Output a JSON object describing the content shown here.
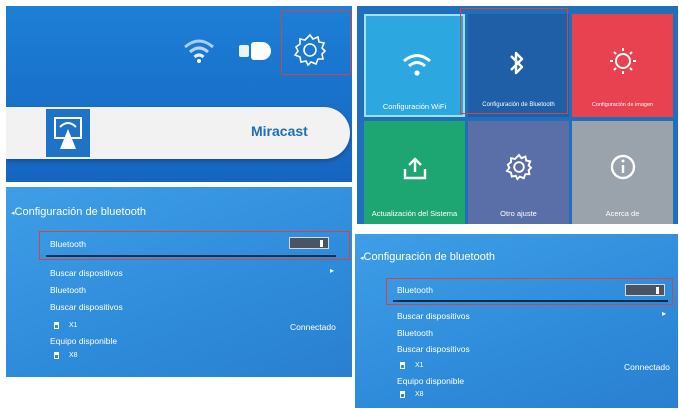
{
  "home": {
    "miracast_label": "Miracast",
    "icons": {
      "wifi": "wifi-icon",
      "usb": "usb-icon",
      "settings": "gear-icon",
      "miracast": "miracast-cast-icon"
    }
  },
  "settings_grid": {
    "tiles": [
      {
        "label": "Configuración WiFi",
        "icon": "wifi-icon",
        "color": "#2da7e0"
      },
      {
        "label": "Configuración de Bluetooth",
        "icon": "bluetooth-icon",
        "color": "#1e5fa8"
      },
      {
        "label": "Configuración de imagen",
        "icon": "sun-icon",
        "color": "#e8414f"
      },
      {
        "label": "Actualización del Sistema",
        "icon": "upload-icon",
        "color": "#1ea672"
      },
      {
        "label": "Otro ajuste",
        "icon": "gear-icon",
        "color": "#5a6ea8"
      },
      {
        "label": "Acerca de",
        "icon": "info-icon",
        "color": "#9aa2ab"
      }
    ]
  },
  "bluetooth_screen": {
    "title": "Configuración de bluetooth",
    "rows": {
      "bluetooth_toggle": "Bluetooth",
      "search_devices": "Buscar dispositivos",
      "bluetooth_header": "Bluetooth",
      "search_devices_header": "Buscar dispositivos",
      "paired_device": "X1",
      "paired_status": "Connectado",
      "available_header": "Equipo disponible",
      "available_device": "X8"
    },
    "toggle_on": true
  },
  "colors": {
    "highlight": "#d24545",
    "accent_blue": "#1e6fb8"
  }
}
